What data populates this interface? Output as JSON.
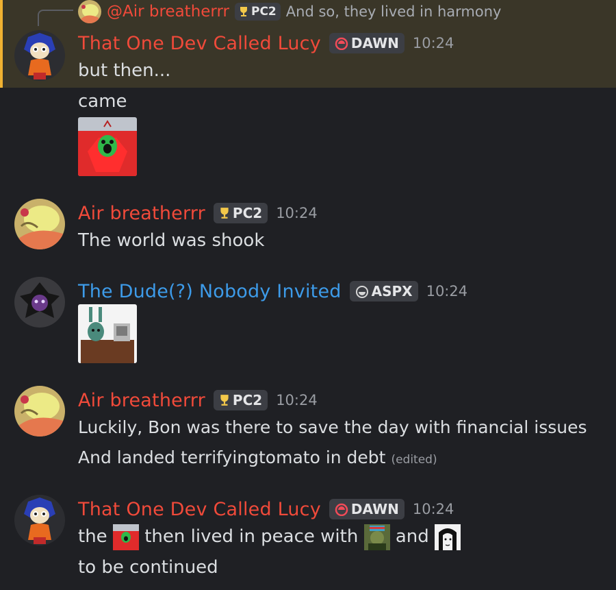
{
  "reply": {
    "name": "@Air breatherrr",
    "tag": "PC2",
    "text": "And so, they lived in harmony"
  },
  "messages": [
    {
      "name": "That One Dev Called Lucy",
      "tag": "DAWN",
      "time": "10:24",
      "lines": [
        "but then...",
        "came"
      ]
    },
    {
      "name": "Air breatherrr",
      "tag": "PC2",
      "time": "10:24",
      "lines": [
        "The world was shook"
      ]
    },
    {
      "name": "The Dude(?) Nobody Invited",
      "tag": "ASPX",
      "time": "10:24"
    },
    {
      "name": "Air breatherrr",
      "tag": "PC2",
      "time": "10:24",
      "lines": [
        "Luckily, Bon was there to save the day with financial issues",
        "And landed terrifyingtomato in debt"
      ],
      "edited": "(edited)"
    },
    {
      "name": "That One Dev Called Lucy",
      "tag": "DAWN",
      "time": "10:24",
      "line1": {
        "a": "the",
        "b": "then lived in peace with",
        "c": "and"
      },
      "lines": [
        "to be continued"
      ]
    }
  ],
  "colors": {
    "name_red": "#f04a3a",
    "name_blue": "#3d9be9",
    "highlight_bar": "#f0b232",
    "background": "#1f2024"
  }
}
